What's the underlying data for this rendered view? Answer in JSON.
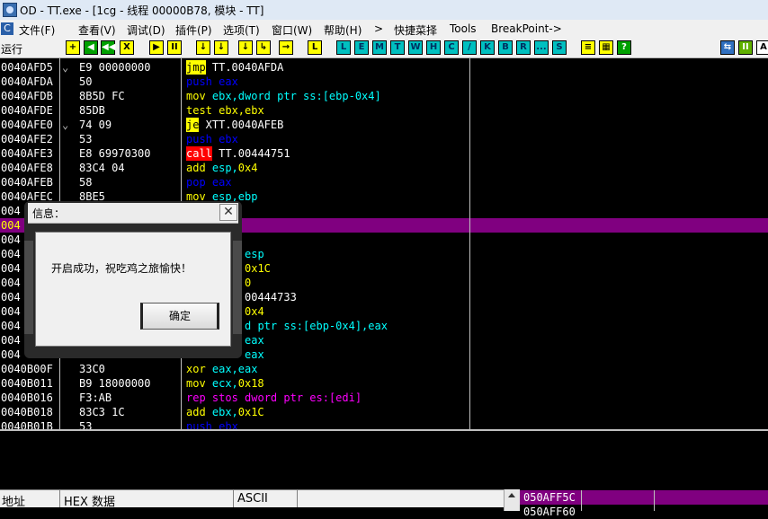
{
  "window": {
    "title": "OD - TT.exe - [1cg - 线程 00000B78, 模块 - TT]"
  },
  "menu": {
    "app_icon_glyph": "C",
    "items": [
      "文件(F)",
      "查看(V)",
      "调试(D)",
      "插件(P)",
      "选项(T)",
      "窗口(W)",
      "帮助(H)",
      ">",
      "快捷菜择",
      "Tools",
      "BreakPoint->"
    ]
  },
  "toolbar": {
    "status": "运行",
    "buttons": [
      "+",
      "◀",
      "◀◀",
      "X",
      "▶",
      "II",
      "↓",
      "↓",
      "↓",
      "↳",
      "→",
      "L",
      "E",
      "M",
      "T",
      "W",
      "H",
      "C",
      "/",
      "K",
      "B",
      "R",
      "...",
      "S",
      "≡",
      "▦",
      "?"
    ],
    "right_buttons": [
      "⇆",
      "II",
      "A"
    ]
  },
  "disasm": {
    "rows": [
      {
        "addr": "0040AFD5",
        "mark": "⌄",
        "hex": "E9 00000000",
        "asm": [
          {
            "t": "jmp",
            "c": "#000000",
            "bg": "#ffff00"
          },
          {
            "t": " TT.0040AFDA",
            "c": "#ffffff"
          }
        ]
      },
      {
        "addr": "0040AFDA",
        "mark": "",
        "hex": "50",
        "asm": [
          {
            "t": "push eax",
            "c": "#0000ff"
          }
        ]
      },
      {
        "addr": "0040AFDB",
        "mark": "",
        "hex": "8B5D FC",
        "asm": [
          {
            "t": "mov ",
            "c": "#ffff00"
          },
          {
            "t": "ebx,dword ptr ss:[ebp-0x4]",
            "c": "#00ffff"
          }
        ]
      },
      {
        "addr": "0040AFDE",
        "mark": "",
        "hex": "85DB",
        "asm": [
          {
            "t": "test ebx,ebx",
            "c": "#ffff00"
          }
        ]
      },
      {
        "addr": "0040AFE0",
        "mark": "⌄",
        "hex": "74 09",
        "asm": [
          {
            "t": "je",
            "c": "#000000",
            "bg": "#ffff00"
          },
          {
            "t": " XTT.0040AFEB",
            "c": "#ffffff"
          }
        ]
      },
      {
        "addr": "0040AFE2",
        "mark": "",
        "hex": "53",
        "asm": [
          {
            "t": "push ebx",
            "c": "#0000ff"
          }
        ]
      },
      {
        "addr": "0040AFE3",
        "mark": "",
        "hex": "E8 69970300",
        "asm": [
          {
            "t": "call",
            "c": "#ffffff",
            "bg": "#ff0000"
          },
          {
            "t": " TT.00444751",
            "c": "#ffffff"
          }
        ]
      },
      {
        "addr": "0040AFE8",
        "mark": "",
        "hex": "83C4 04",
        "asm": [
          {
            "t": "add ",
            "c": "#ffff00"
          },
          {
            "t": "esp,",
            "c": "#00ffff"
          },
          {
            "t": "0x4",
            "c": "#ffff00"
          }
        ]
      },
      {
        "addr": "0040AFEB",
        "mark": "",
        "hex": "58",
        "asm": [
          {
            "t": "pop eax",
            "c": "#0000ff"
          }
        ]
      },
      {
        "addr": "0040AFEC",
        "mark": "",
        "hex": "8BE5",
        "asm": [
          {
            "t": "mov ",
            "c": "#ffff00"
          },
          {
            "t": "esp,ebp",
            "c": "#00ffff"
          }
        ]
      },
      {
        "addr": "004",
        "mark": "",
        "hex": "",
        "asm": []
      },
      {
        "addr": "004",
        "mark": "",
        "hex": "",
        "asm": [],
        "selected": true
      },
      {
        "addr": "004",
        "mark": "",
        "hex": "",
        "asm": []
      },
      {
        "addr": "004",
        "mark": "",
        "hex": "",
        "asm": [
          {
            "t": "esp",
            "c": "#00ffff"
          }
        ]
      },
      {
        "addr": "004",
        "mark": "",
        "hex": "",
        "asm": [
          {
            "t": "0x1C",
            "c": "#ffff00"
          }
        ]
      },
      {
        "addr": "004",
        "mark": "",
        "hex": "",
        "asm": [
          {
            "t": "0",
            "c": "#ffff00"
          }
        ]
      },
      {
        "addr": "004",
        "mark": "",
        "hex": "",
        "asm": [
          {
            "t": "00444733",
            "c": "#ffffff"
          }
        ]
      },
      {
        "addr": "004",
        "mark": "",
        "hex": "",
        "asm": [
          {
            "t": "0x4",
            "c": "#ffff00"
          }
        ]
      },
      {
        "addr": "004",
        "mark": "",
        "hex": "",
        "asm": [
          {
            "t": "d ptr ss:[ebp-0x4],eax",
            "c": "#00ffff"
          }
        ]
      },
      {
        "addr": "004",
        "mark": "",
        "hex": "",
        "asm": [
          {
            "t": "eax",
            "c": "#00ffff"
          }
        ]
      },
      {
        "addr": "004",
        "mark": "",
        "hex": "",
        "asm": [
          {
            "t": "eax",
            "c": "#00ffff"
          }
        ]
      },
      {
        "addr": "0040B00F",
        "mark": "",
        "hex": "33C0",
        "asm": [
          {
            "t": "xor ",
            "c": "#ffff00"
          },
          {
            "t": "eax,eax",
            "c": "#00ffff"
          }
        ]
      },
      {
        "addr": "0040B011",
        "mark": "",
        "hex": "B9 18000000",
        "asm": [
          {
            "t": "mov ",
            "c": "#ffff00"
          },
          {
            "t": "ecx,",
            "c": "#00ffff"
          },
          {
            "t": "0x18",
            "c": "#ffff00"
          }
        ]
      },
      {
        "addr": "0040B016",
        "mark": "",
        "hex": "F3:AB",
        "asm": [
          {
            "t": "rep stos dword ptr es:[edi]",
            "c": "#ff00ff"
          }
        ]
      },
      {
        "addr": "0040B018",
        "mark": "",
        "hex": "83C3 1C",
        "asm": [
          {
            "t": "add ",
            "c": "#ffff00"
          },
          {
            "t": "ebx,",
            "c": "#00ffff"
          },
          {
            "t": "0x1C",
            "c": "#ffff00"
          }
        ]
      },
      {
        "addr": "0040B01B",
        "mark": "",
        "hex": "53",
        "asm": [
          {
            "t": "push ebx",
            "c": "#0000ff"
          }
        ]
      }
    ]
  },
  "dump": {
    "headers": {
      "address": "地址",
      "hex": "HEX 数据",
      "ascii": "ASCII"
    }
  },
  "stack": {
    "rows": [
      "050AFF5C",
      "050AFF60"
    ]
  },
  "dialog": {
    "title": "信息：",
    "close_glyph": "✕",
    "message": "开启成功，祝吃鸡之旅愉快！",
    "ok_label": "确定"
  },
  "colors": {
    "selection": "#800080",
    "disasm_bg": "#000000",
    "jump_highlight": "#ffff00",
    "call_highlight": "#ff0000",
    "register_text": "#00ffff",
    "push_pop_text": "#0000ff"
  }
}
